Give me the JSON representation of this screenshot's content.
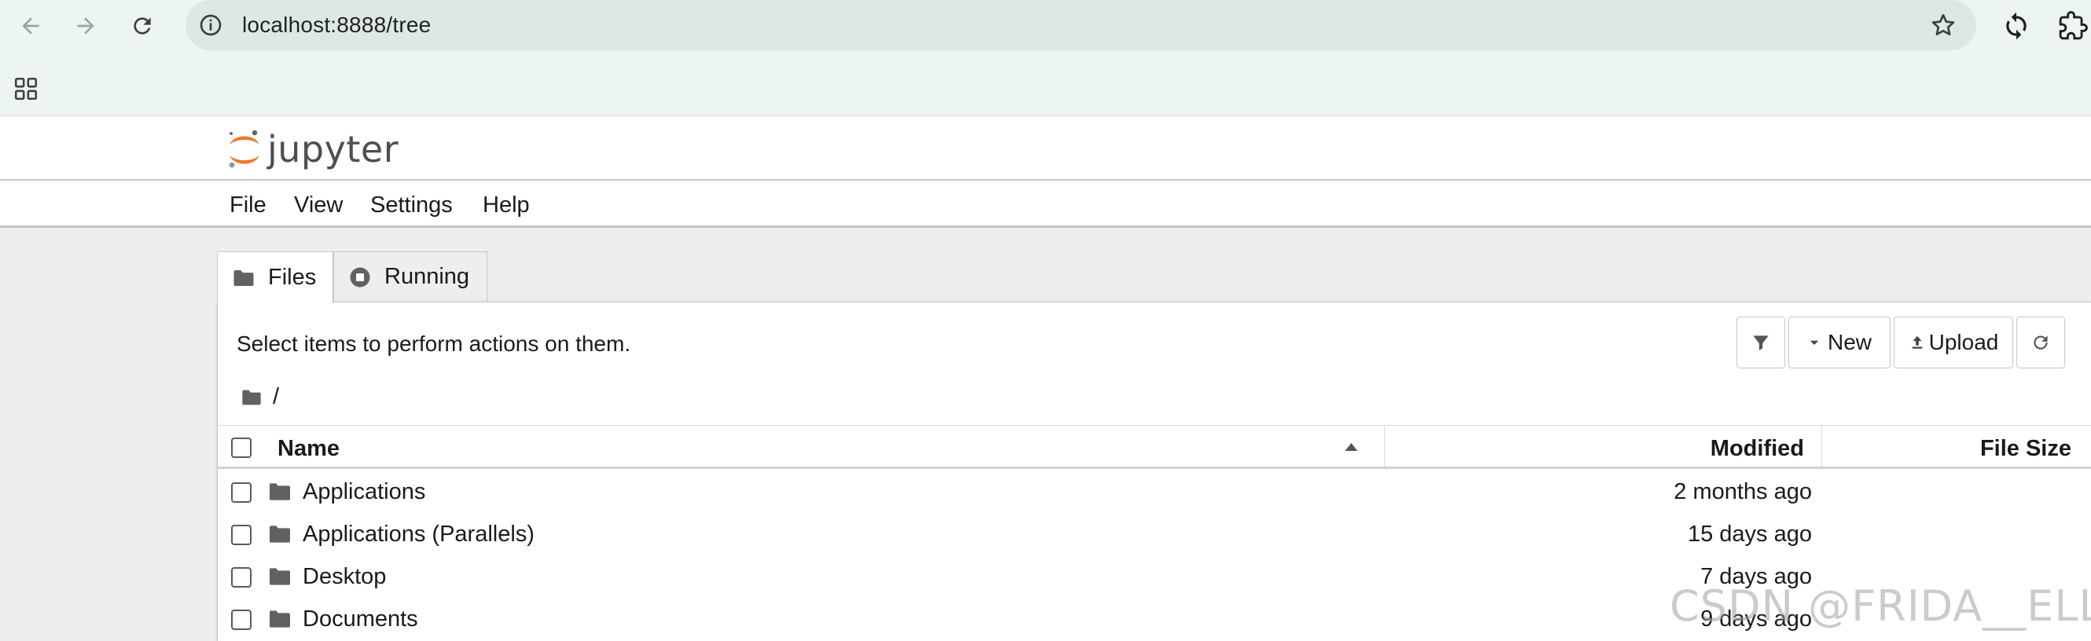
{
  "browser": {
    "url": "localhost:8888/tree",
    "icons": {
      "back": "arrow-left-icon",
      "forward": "arrow-right-icon",
      "reload": "reload-icon",
      "site_info": "info-icon",
      "bookmark": "star-icon",
      "sync": "sync-icon",
      "extensions": "puzzle-icon",
      "apps": "apps-grid-icon"
    }
  },
  "jupyter": {
    "logo_text": "jupyter",
    "logo_color": "#f37726",
    "menu": [
      "File",
      "View",
      "Settings",
      "Help"
    ]
  },
  "tabs": [
    {
      "label": "Files",
      "icon": "folder-icon",
      "active": true
    },
    {
      "label": "Running",
      "icon": "stop-circle-icon",
      "active": false
    }
  ],
  "file_browser": {
    "hint": "Select items to perform actions on them.",
    "toolbar": {
      "filter_icon": "filter-icon",
      "new_label": "New",
      "upload_label": "Upload",
      "refresh_icon": "refresh-icon"
    },
    "breadcrumb": "/",
    "columns": {
      "name": "Name",
      "modified": "Modified",
      "size": "File Size"
    },
    "rows": [
      {
        "name": "Applications",
        "modified": "2 months ago"
      },
      {
        "name": "Applications (Parallels)",
        "modified": "15 days ago"
      },
      {
        "name": "Desktop",
        "modified": "7 days ago"
      },
      {
        "name": "Documents",
        "modified": "9 days ago"
      }
    ]
  },
  "watermark": "CSDN @FRIDA__ELLEN"
}
